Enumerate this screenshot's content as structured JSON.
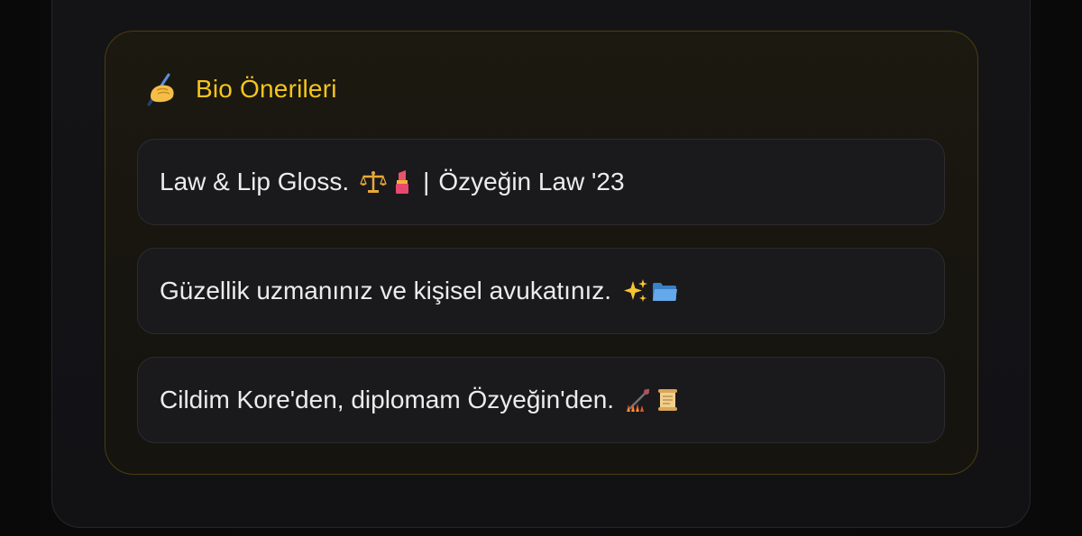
{
  "panel": {
    "title": "Bio Önerileri",
    "header_icon": "writing-hand-icon",
    "accent_color": "#f5c51c"
  },
  "suggestions": [
    {
      "text": "Law & Lip Gloss.",
      "emojis": [
        "balance-scale-icon",
        "lipstick-icon"
      ],
      "separator": "|",
      "suffix": "Özyeğin Law '23"
    },
    {
      "text": "Güzellik uzmanınız ve kişisel avukatınız.",
      "emojis": [
        "sparkles-icon",
        "folder-icon"
      ]
    },
    {
      "text": "Cildim Kore'den, diplomam Özyeğin'den.",
      "emojis": [
        "mascara-icon",
        "scroll-icon"
      ]
    }
  ]
}
